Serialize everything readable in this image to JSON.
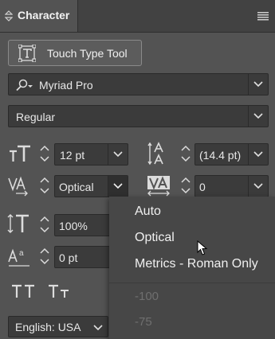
{
  "panel": {
    "tab_title": "Character",
    "menu_icon": "hamburger-menu-icon"
  },
  "touch_type_tool": {
    "label": "Touch Type Tool"
  },
  "font_family": {
    "value": "Myriad Pro"
  },
  "font_style": {
    "value": "Regular"
  },
  "font_size": {
    "value": "12 pt"
  },
  "leading": {
    "value": "(14.4 pt)"
  },
  "kerning": {
    "value": "Optical"
  },
  "tracking": {
    "value": "0"
  },
  "vertical_scale": {
    "value": "100%"
  },
  "baseline_shift": {
    "value": "0 pt"
  },
  "language": {
    "value": "English: USA"
  },
  "kerning_menu": {
    "items": [
      "Auto",
      "Optical",
      "Metrics - Roman Only"
    ],
    "disabled_items": [
      "-100",
      "-75"
    ]
  },
  "colors": {
    "panel_bg": "#535353",
    "header_bg": "#424242",
    "field_bg": "#3b3b3b",
    "menu_bg": "#474747",
    "text": "#e6e6e6",
    "disabled_text": "#6f6f6f"
  }
}
